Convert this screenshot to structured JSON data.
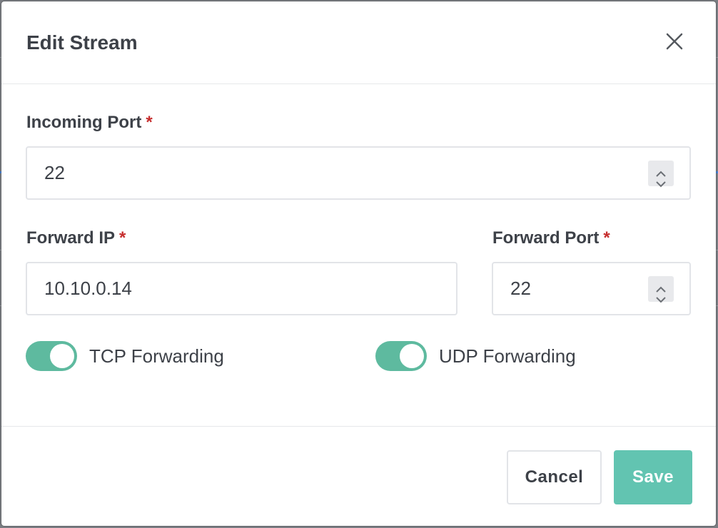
{
  "dialog": {
    "title": "Edit Stream",
    "close_icon": "close-icon"
  },
  "fields": {
    "incoming_port": {
      "label": "Incoming Port",
      "required_mark": "*",
      "value": "22"
    },
    "forward_ip": {
      "label": "Forward IP",
      "required_mark": "*",
      "value": "10.10.0.14"
    },
    "forward_port": {
      "label": "Forward Port",
      "required_mark": "*",
      "value": "22"
    }
  },
  "toggles": {
    "tcp": {
      "label": "TCP Forwarding",
      "on": true
    },
    "udp": {
      "label": "UDP Forwarding",
      "on": true
    }
  },
  "buttons": {
    "cancel": "Cancel",
    "save": "Save"
  },
  "colors": {
    "accent": "#5eba9f",
    "save_button": "#62c4b1",
    "required": "#c62d2d",
    "text": "#3d4148"
  }
}
